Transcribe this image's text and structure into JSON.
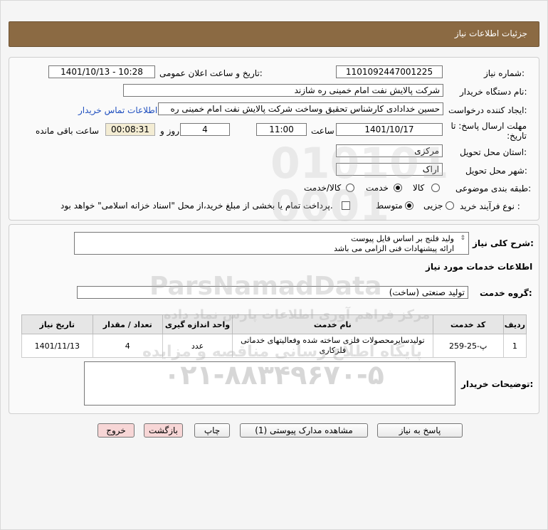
{
  "header": {
    "title": "جزئیات اطلاعات نیاز"
  },
  "form": {
    "need_number_label": "شماره نیاز:",
    "need_number": "1101092447001225",
    "announce_label": "تاریخ و ساعت اعلان عمومی:",
    "announce_value": "1401/10/13 - 10:28",
    "buyer_org_label": "نام دستگاه خریدار:",
    "buyer_org": "شرکت پالایش نفت امام خمینی  ره  شازند",
    "creator_label": "ایجاد کننده درخواست:",
    "creator": "حسین خدادادی کارشناس تحقیق وساخت شرکت پالایش نفت امام خمینی  ره",
    "buyer_contact_link": "اطلاعات تماس خریدار",
    "deadline_label": "مهلت ارسال پاسخ: تا تاریخ:",
    "deadline_date": "1401/10/17",
    "time_label": "ساعت",
    "deadline_time": "11:00",
    "days_value": "4",
    "days_label": "روز و",
    "remaining_time": "00:08:31",
    "remaining_label": "ساعت باقی مانده",
    "province_label": "استان محل تحویل:",
    "province": "مرکزی",
    "city_label": "شهر محل تحویل:",
    "city": "اراک",
    "category_label": "طبقه بندی موضوعی:",
    "category_options": [
      "کالا",
      "خدمت",
      "کالا/خدمت"
    ],
    "category_selected": "خدمت",
    "process_label": "نوع فرآیند خرید :",
    "process_options": [
      "جزیی",
      "متوسط"
    ],
    "process_selected": "متوسط",
    "payment_note": "پرداخت تمام یا بخشی از مبلغ خرید،از محل \"اسناد خزانه اسلامی\" خواهد بود."
  },
  "summary": {
    "label": "شرح کلی نیاز:",
    "line1": "ولید فلنج بر اساس فایل پیوست",
    "line2": "ارائه پیشنهادات فنی الزامی می باشد"
  },
  "services": {
    "section_title": "اطلاعات خدمات مورد نیاز",
    "group_label": "گروه خدمت:",
    "group_value": "تولید صنعتی (ساخت)"
  },
  "table": {
    "headers": [
      "ردیف",
      "کد خدمت",
      "نام خدمت",
      "واحد اندازه گیری",
      "تعداد / مقدار",
      "تاریخ نیاز"
    ],
    "rows": [
      {
        "row": "1",
        "code": "پ-25-259",
        "name": "تولیدسایرمحصولات فلزی ساخته شده وفعالیتهای خدماتی فلزکاری",
        "unit": "عدد",
        "qty": "4",
        "date": "1401/11/13"
      }
    ]
  },
  "buyer_notes": {
    "label": "توضیحات خریدار:",
    "value": ""
  },
  "buttons": {
    "reply": "پاسخ به نیاز",
    "attachments": "مشاهده مدارک پیوستی (1)",
    "print": "چاپ",
    "back": "بازگشت",
    "exit": "خروج"
  },
  "watermark": {
    "line1": "ParsNamadData",
    "line2": "مرکز فراهم آوری اطلاعات پارس نماد داده",
    "line3": "پایگاه اطلاع رسانی مناقصه و مزایده",
    "phone": "۰۲۱-۸۸۳۴۹۶۷۰-۵"
  },
  "colors": {
    "header_bg": "#8b6a43",
    "link": "#1f4fbf",
    "exit_btn": "#f7d6d6",
    "back_btn": "#f7d6d6"
  }
}
